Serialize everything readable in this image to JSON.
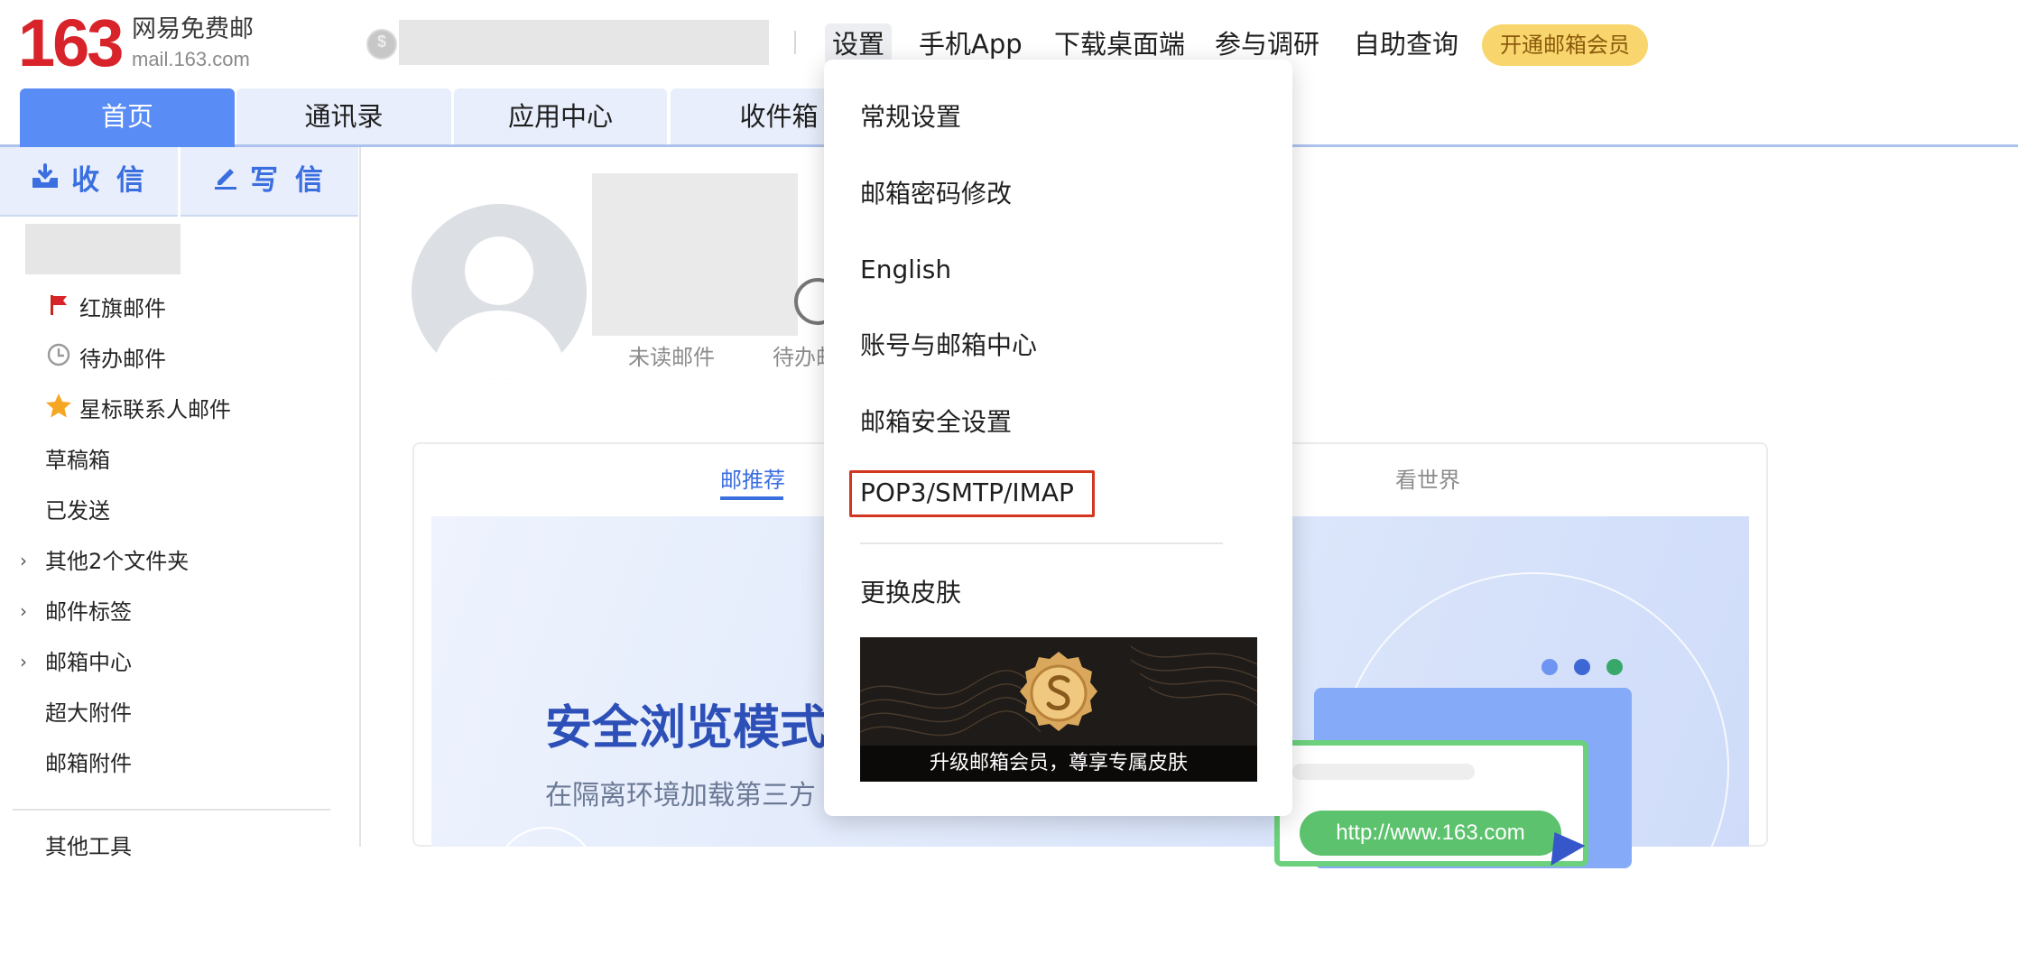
{
  "header": {
    "logo_number": "163",
    "logo_name": "网易免费邮",
    "logo_domain": "mail.163.com",
    "nav": {
      "settings": "设置",
      "mobile_app": "手机App",
      "desktop": "下载桌面端",
      "survey": "参与调研",
      "self_help": "自助查询",
      "vip": "开通邮箱会员"
    }
  },
  "tabs": {
    "home": "首页",
    "contacts": "通讯录",
    "apps": "应用中心",
    "inbox": "收件箱"
  },
  "sidebar": {
    "receive": "收 信",
    "compose": "写 信",
    "items": {
      "flagged": "红旗邮件",
      "todo": "待办邮件",
      "starred": "星标联系人邮件",
      "drafts": "草稿箱",
      "sent": "已发送",
      "other_folders": "其他2个文件夹",
      "labels": "邮件标签",
      "mailbox_center": "邮箱中心",
      "large_attachments": "超大附件",
      "attachments": "邮箱附件",
      "other_tools": "其他工具"
    }
  },
  "profile": {
    "unread_label": "未读邮件",
    "todo_label": "待办邮"
  },
  "content": {
    "tab_recommend": "邮推荐",
    "tab_world": "看世界",
    "banner_title": "安全浏览模式",
    "banner_subtitle": "在隔离环境加载第三方",
    "banner_url": "http://www.163.com"
  },
  "settings_menu": {
    "items": {
      "general": "常规设置",
      "password": "邮箱密码修改",
      "english": "English",
      "account_center": "账号与邮箱中心",
      "security": "邮箱安全设置",
      "pop3": "POP3/SMTP/IMAP",
      "skin": "更换皮肤"
    },
    "skin_promo": "升级邮箱会员，尊享专属皮肤"
  },
  "colors": {
    "brand_red": "#d8232a",
    "accent_blue": "#5a8cf5",
    "highlight_red": "#d2361f",
    "vip_yellow": "#f8d66d"
  }
}
